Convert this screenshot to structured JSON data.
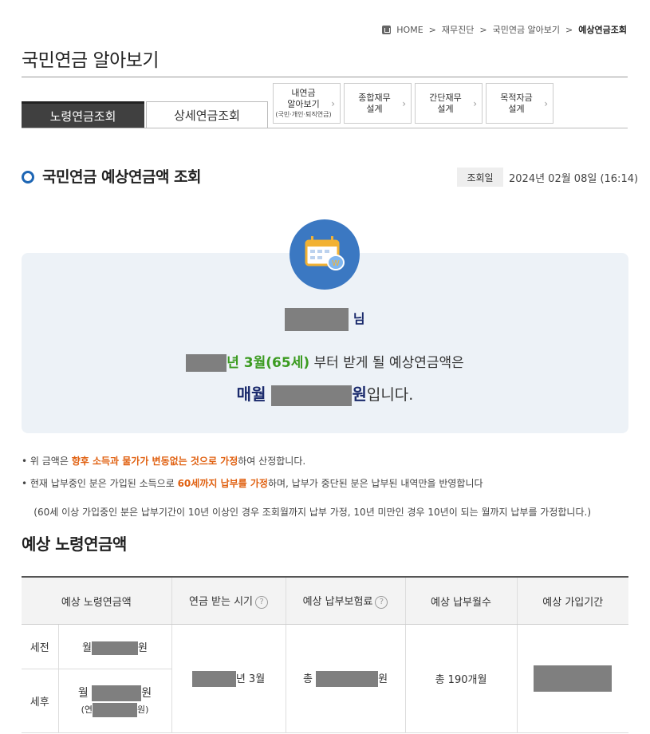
{
  "breadcrumb": {
    "home": "HOME",
    "items": [
      "재무진단",
      "국민연금 알아보기"
    ],
    "current": "예상연금조회"
  },
  "page_title": "국민연금 알아보기",
  "tabs": {
    "main": [
      "노령연금조회",
      "상세연금조회"
    ],
    "sub": [
      {
        "line1": "내연금",
        "line2": "알아보기",
        "line3": "(국민·개인·퇴직연금)"
      },
      {
        "line1": "종합재무",
        "line2": "설계"
      },
      {
        "line1": "간단재무",
        "line2": "설계"
      },
      {
        "line1": "목적자금",
        "line2": "설계"
      }
    ]
  },
  "section": {
    "title": "국민연금 예상연금액 조회",
    "date_label": "조회일",
    "date_value": "2024년 02월 08일 (16:14)"
  },
  "summary": {
    "name_suffix": "님",
    "start_highlight": "년 3월(65세)",
    "start_rest": " 부터 받게 될 예상연금액은",
    "monthly_prefix": "매월 ",
    "monthly_unit": "원",
    "monthly_suffix": "입니다."
  },
  "notes": [
    {
      "pre": "• 위 금액은 ",
      "hl": "향후 소득과 물가가 변동없는 것으로 가정",
      "post": "하여 산정합니다."
    },
    {
      "pre": "• 현재 납부중인 분은 가입된 소득으로 ",
      "hl": "60세까지 납부를 가정",
      "post": "하며, 납부가 중단된 분은 납부된 내역만을 반영합니다"
    },
    {
      "pre": "  (60세 이상 가입중인 분은 납부기간이 10년 이상인 경우 조회월까지 납부 가정, 10년 미만인 경우 10년이 되는 월까지 납부를 가정합니다.)",
      "hl": "",
      "post": ""
    }
  ],
  "table_title": "예상 노령연금액",
  "table": {
    "headers": [
      "예상 노령연금액",
      "연금 받는 시기",
      "예상 납부보험료",
      "예상 납부월수",
      "예상 가입기간"
    ],
    "help_icon": "?",
    "row_labels": [
      "세전",
      "세후"
    ],
    "month_prefix": "월",
    "won": "원",
    "yearly_prefix": "(연",
    "yearly_suffix": "원)",
    "start_suffix": "년 3월",
    "premium_prefix": "총",
    "months_value": "총 190개월"
  }
}
